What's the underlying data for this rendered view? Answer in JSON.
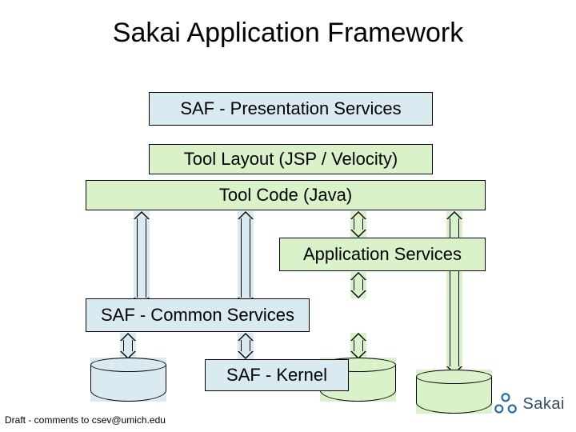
{
  "title": "Sakai Application Framework",
  "boxes": {
    "presentation": "SAF - Presentation Services",
    "toolLayout": "Tool Layout (JSP / Velocity)",
    "toolCode": "Tool Code (Java)",
    "appServices": "Application Services",
    "commonServices": "SAF - Common Services",
    "kernel": "SAF - Kernel"
  },
  "footer": "Draft - comments to csev@umich.edu",
  "logo": {
    "text": "Sakai"
  },
  "colors": {
    "blue": "#d9eaf0",
    "green": "#d9f2c9"
  }
}
